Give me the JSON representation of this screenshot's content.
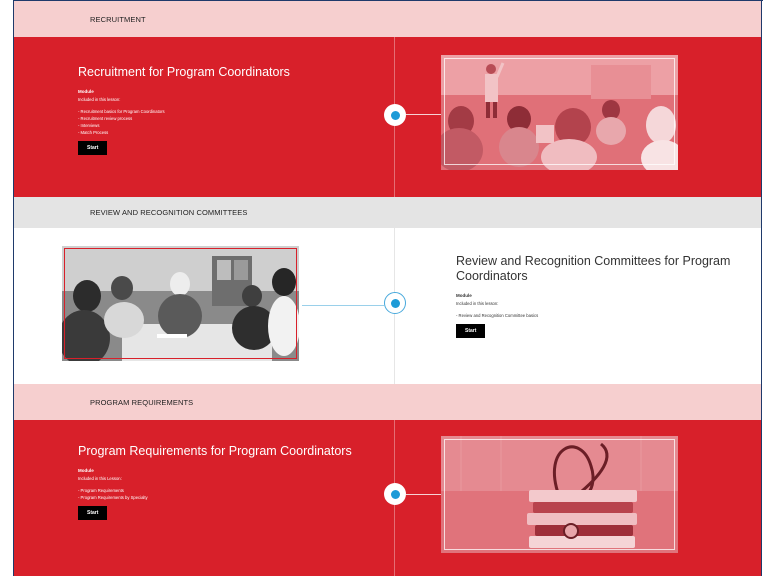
{
  "sections": [
    {
      "header": "RECRUITMENT",
      "title": "Recruitment for Program Coordinators",
      "module_label": "Module",
      "included_label": "Included in this lesson:",
      "items": [
        "- Recruitment basics for Program Coordinators",
        "- Recruitment review process",
        "- Interviews",
        "- Match Process"
      ],
      "start_label": "Start",
      "image_subject": "lecture-classroom"
    },
    {
      "header": "REVIEW AND RECOGNITION COMMITTEES",
      "title_line1": "Review and Recognition Committees for Program",
      "title_line2": "Coordinators",
      "module_label": "Module",
      "included_label": "Included in this lesson:",
      "items": [
        "- Review and Recognition Committee basics"
      ],
      "start_label": "Start",
      "image_subject": "team-meeting"
    },
    {
      "header": "PROGRAM REQUIREMENTS",
      "title": "Program Requirements for Program Coordinators",
      "module_label": "Module",
      "included_label": "Included in this Lesson:",
      "items": [
        "- Program Requirements",
        "- Program Requirements by Specialty"
      ],
      "start_label": "Start",
      "image_subject": "stethoscope-books"
    }
  ],
  "colors": {
    "accent_red": "#d8202a",
    "band_pink": "#f6cfcf",
    "band_grey": "#e4e4e4",
    "dot_blue": "#1e9bd7"
  }
}
